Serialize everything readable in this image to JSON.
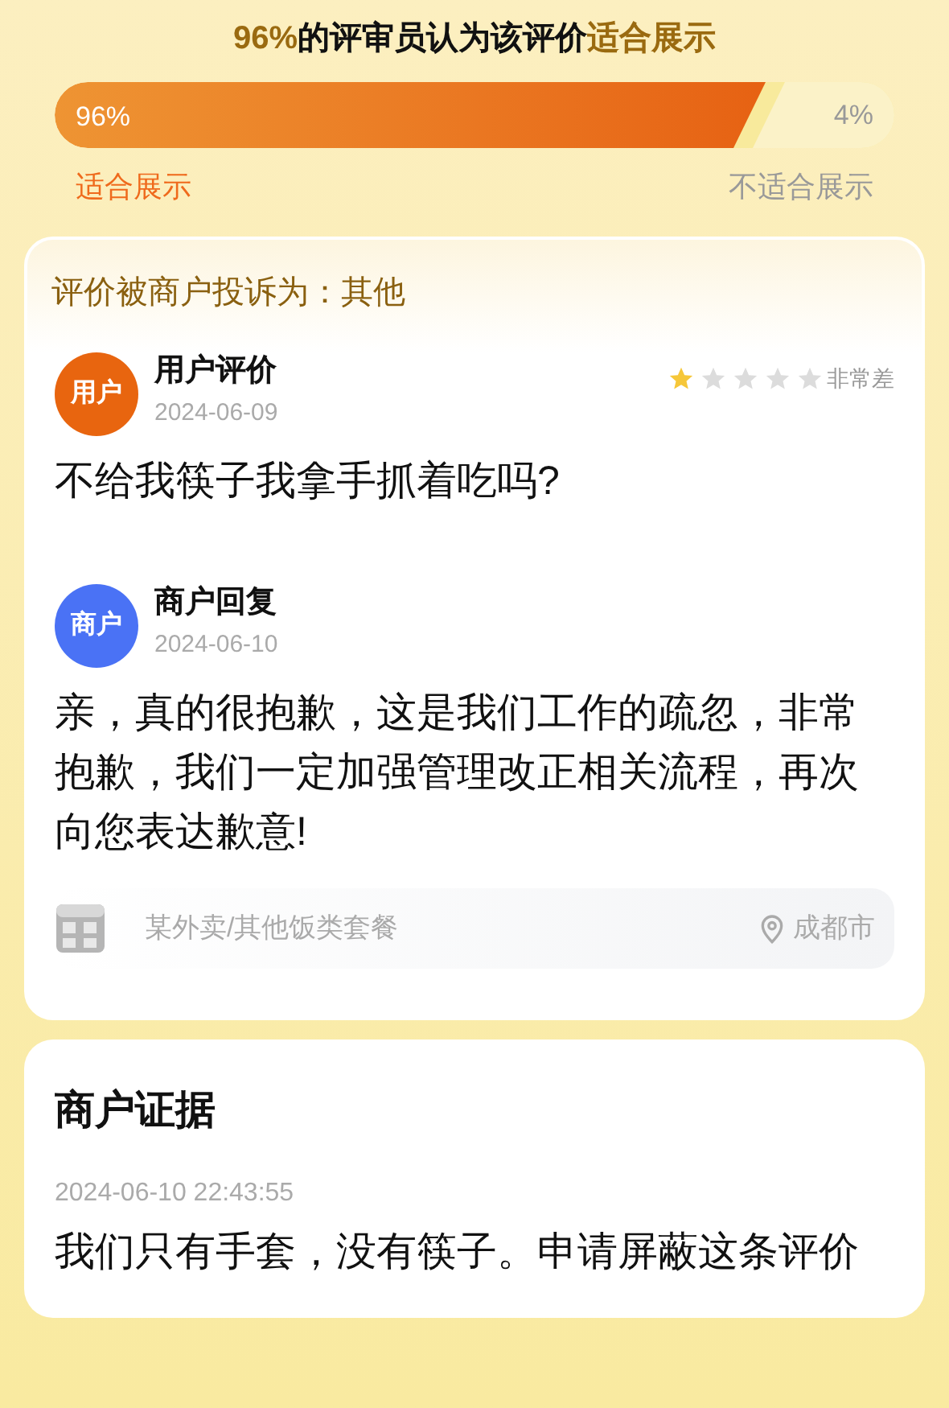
{
  "verdict": {
    "share": "96%",
    "text": "的评审员认为该评价",
    "result": "适合展示"
  },
  "vote_bar": {
    "level": 0.96,
    "left_reading": "96%",
    "right_reading": "4%",
    "left_label": "适合展示",
    "right_label": "不适合展示"
  },
  "complaint": {
    "text": "评价被商户投诉为：其他"
  },
  "posts": [
    {
      "kind": "user",
      "badge": "用户",
      "title": "用户评价",
      "date": "2024-06-09",
      "stars": 1,
      "rating_label": "非常差",
      "body": "不给我筷子我拿手抓着吃吗?"
    },
    {
      "kind": "merchant",
      "badge": "商户",
      "title": "商户回复",
      "date": "2024-06-10",
      "body": "亲，真的很抱歉，这是我们工作的疏忽，非常抱歉，我们一定加强管理改正相关流程，再次向您表达歉意!"
    }
  ],
  "shop": {
    "category": "某外卖/其他饭类套餐",
    "city": "成都市"
  },
  "evidence": {
    "title": "商户证据",
    "timestamp": "2024-06-10 22:43:55",
    "text": "我们只有手套，没有筷子。申请屏蔽这条评价"
  }
}
